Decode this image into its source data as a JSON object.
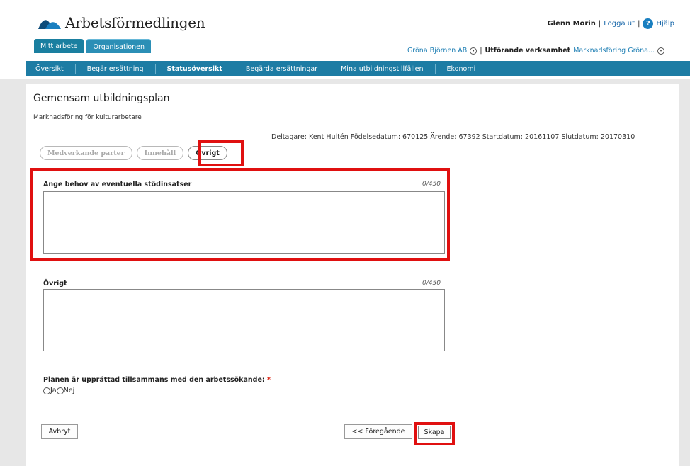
{
  "header": {
    "logo_text": "Arbetsförmedlingen",
    "user_name": "Glenn Morin",
    "logout": "Logga ut",
    "help": "Hjälp",
    "help_icon_glyph": "?",
    "separator": "|"
  },
  "top_tabs": [
    {
      "label": "Mitt arbete"
    },
    {
      "label": "Organisationen"
    }
  ],
  "org_bar": {
    "company": "Gröna Björnen AB",
    "sep": "|",
    "verksamhet_label": "Utförande verksamhet",
    "verksamhet_value": "Marknadsföring Gröna..."
  },
  "nav": [
    {
      "label": "Översikt"
    },
    {
      "label": "Begär ersättning"
    },
    {
      "label": "Statusöversikt"
    },
    {
      "label": "Begärda ersättningar"
    },
    {
      "label": "Mina utbildningstillfällen"
    },
    {
      "label": "Ekonomi"
    }
  ],
  "page": {
    "title": "Gemensam utbildningsplan",
    "subtitle": "Marknadsföring för kulturarbetare",
    "meta": "Deltagare: Kent Hultén Födelsedatum: 670125 Ärende: 67392 Startdatum: 20161107 Slutdatum: 20170310"
  },
  "steps": [
    {
      "label": "Medverkande parter"
    },
    {
      "label": "Innehåll"
    },
    {
      "label": "Övrigt"
    }
  ],
  "fields": {
    "stod_label": "Ange behov av eventuella stödinsatser",
    "stod_counter": "0/450",
    "stod_value": "",
    "ovrigt_label": "Övrigt",
    "ovrigt_counter": "0/450",
    "ovrigt_value": ""
  },
  "radio_group": {
    "label": "Planen är upprättad tillsammans med den arbetssökande:",
    "required_mark": "*",
    "options": [
      "Ja",
      "Nej"
    ],
    "selected": null
  },
  "buttons": {
    "cancel": "Avbryt",
    "previous": "<< Föregående",
    "create": "Skapa"
  },
  "colors": {
    "nav_bg": "#1d7ca4",
    "highlight": "#e01010",
    "link": "#1f7fb4"
  }
}
